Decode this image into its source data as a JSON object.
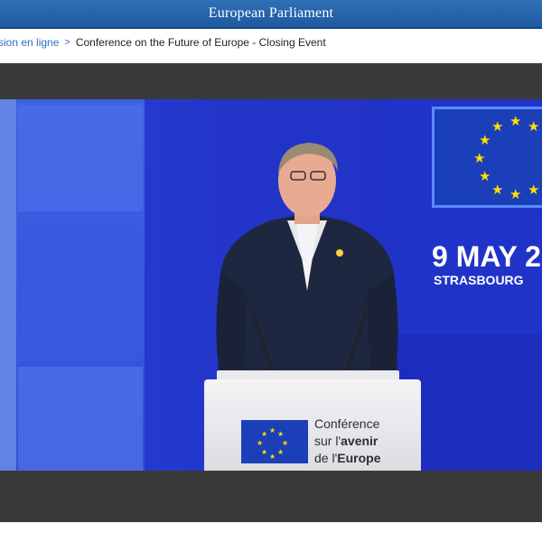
{
  "header": {
    "title": "European Parliament"
  },
  "breadcrumb": {
    "parent": "sion en ligne",
    "separator": ">",
    "current": "Conference on the Future of Europe - Closing Event"
  },
  "video": {
    "date_text": "9 MAY 2",
    "city_text": "STRASBOURG",
    "podium_line1": "Conférence",
    "podium_line2a": "sur l'",
    "podium_line2b": "avenir",
    "podium_line3a": "de l'",
    "podium_line3b": "Europe"
  },
  "colors": {
    "header_blue": "#2f6fb6",
    "stage_blue": "#2335c9",
    "eu_yellow": "#ffdd00"
  }
}
